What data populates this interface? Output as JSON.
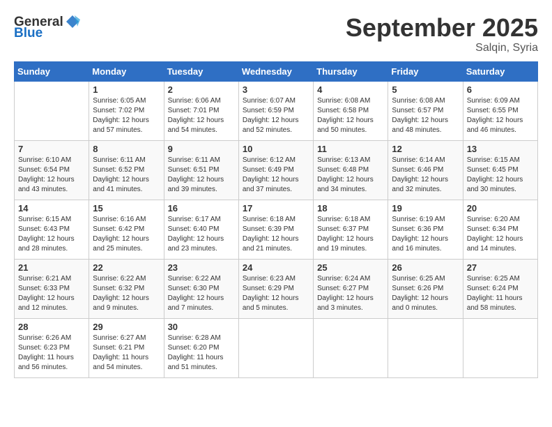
{
  "header": {
    "logo_general": "General",
    "logo_blue": "Blue",
    "month": "September 2025",
    "location": "Salqin, Syria"
  },
  "days_of_week": [
    "Sunday",
    "Monday",
    "Tuesday",
    "Wednesday",
    "Thursday",
    "Friday",
    "Saturday"
  ],
  "weeks": [
    [
      {
        "day": "",
        "content": ""
      },
      {
        "day": "1",
        "content": "Sunrise: 6:05 AM\nSunset: 7:02 PM\nDaylight: 12 hours\nand 57 minutes."
      },
      {
        "day": "2",
        "content": "Sunrise: 6:06 AM\nSunset: 7:01 PM\nDaylight: 12 hours\nand 54 minutes."
      },
      {
        "day": "3",
        "content": "Sunrise: 6:07 AM\nSunset: 6:59 PM\nDaylight: 12 hours\nand 52 minutes."
      },
      {
        "day": "4",
        "content": "Sunrise: 6:08 AM\nSunset: 6:58 PM\nDaylight: 12 hours\nand 50 minutes."
      },
      {
        "day": "5",
        "content": "Sunrise: 6:08 AM\nSunset: 6:57 PM\nDaylight: 12 hours\nand 48 minutes."
      },
      {
        "day": "6",
        "content": "Sunrise: 6:09 AM\nSunset: 6:55 PM\nDaylight: 12 hours\nand 46 minutes."
      }
    ],
    [
      {
        "day": "7",
        "content": "Sunrise: 6:10 AM\nSunset: 6:54 PM\nDaylight: 12 hours\nand 43 minutes."
      },
      {
        "day": "8",
        "content": "Sunrise: 6:11 AM\nSunset: 6:52 PM\nDaylight: 12 hours\nand 41 minutes."
      },
      {
        "day": "9",
        "content": "Sunrise: 6:11 AM\nSunset: 6:51 PM\nDaylight: 12 hours\nand 39 minutes."
      },
      {
        "day": "10",
        "content": "Sunrise: 6:12 AM\nSunset: 6:49 PM\nDaylight: 12 hours\nand 37 minutes."
      },
      {
        "day": "11",
        "content": "Sunrise: 6:13 AM\nSunset: 6:48 PM\nDaylight: 12 hours\nand 34 minutes."
      },
      {
        "day": "12",
        "content": "Sunrise: 6:14 AM\nSunset: 6:46 PM\nDaylight: 12 hours\nand 32 minutes."
      },
      {
        "day": "13",
        "content": "Sunrise: 6:15 AM\nSunset: 6:45 PM\nDaylight: 12 hours\nand 30 minutes."
      }
    ],
    [
      {
        "day": "14",
        "content": "Sunrise: 6:15 AM\nSunset: 6:43 PM\nDaylight: 12 hours\nand 28 minutes."
      },
      {
        "day": "15",
        "content": "Sunrise: 6:16 AM\nSunset: 6:42 PM\nDaylight: 12 hours\nand 25 minutes."
      },
      {
        "day": "16",
        "content": "Sunrise: 6:17 AM\nSunset: 6:40 PM\nDaylight: 12 hours\nand 23 minutes."
      },
      {
        "day": "17",
        "content": "Sunrise: 6:18 AM\nSunset: 6:39 PM\nDaylight: 12 hours\nand 21 minutes."
      },
      {
        "day": "18",
        "content": "Sunrise: 6:18 AM\nSunset: 6:37 PM\nDaylight: 12 hours\nand 19 minutes."
      },
      {
        "day": "19",
        "content": "Sunrise: 6:19 AM\nSunset: 6:36 PM\nDaylight: 12 hours\nand 16 minutes."
      },
      {
        "day": "20",
        "content": "Sunrise: 6:20 AM\nSunset: 6:34 PM\nDaylight: 12 hours\nand 14 minutes."
      }
    ],
    [
      {
        "day": "21",
        "content": "Sunrise: 6:21 AM\nSunset: 6:33 PM\nDaylight: 12 hours\nand 12 minutes."
      },
      {
        "day": "22",
        "content": "Sunrise: 6:22 AM\nSunset: 6:32 PM\nDaylight: 12 hours\nand 9 minutes."
      },
      {
        "day": "23",
        "content": "Sunrise: 6:22 AM\nSunset: 6:30 PM\nDaylight: 12 hours\nand 7 minutes."
      },
      {
        "day": "24",
        "content": "Sunrise: 6:23 AM\nSunset: 6:29 PM\nDaylight: 12 hours\nand 5 minutes."
      },
      {
        "day": "25",
        "content": "Sunrise: 6:24 AM\nSunset: 6:27 PM\nDaylight: 12 hours\nand 3 minutes."
      },
      {
        "day": "26",
        "content": "Sunrise: 6:25 AM\nSunset: 6:26 PM\nDaylight: 12 hours\nand 0 minutes."
      },
      {
        "day": "27",
        "content": "Sunrise: 6:25 AM\nSunset: 6:24 PM\nDaylight: 11 hours\nand 58 minutes."
      }
    ],
    [
      {
        "day": "28",
        "content": "Sunrise: 6:26 AM\nSunset: 6:23 PM\nDaylight: 11 hours\nand 56 minutes."
      },
      {
        "day": "29",
        "content": "Sunrise: 6:27 AM\nSunset: 6:21 PM\nDaylight: 11 hours\nand 54 minutes."
      },
      {
        "day": "30",
        "content": "Sunrise: 6:28 AM\nSunset: 6:20 PM\nDaylight: 11 hours\nand 51 minutes."
      },
      {
        "day": "",
        "content": ""
      },
      {
        "day": "",
        "content": ""
      },
      {
        "day": "",
        "content": ""
      },
      {
        "day": "",
        "content": ""
      }
    ]
  ]
}
